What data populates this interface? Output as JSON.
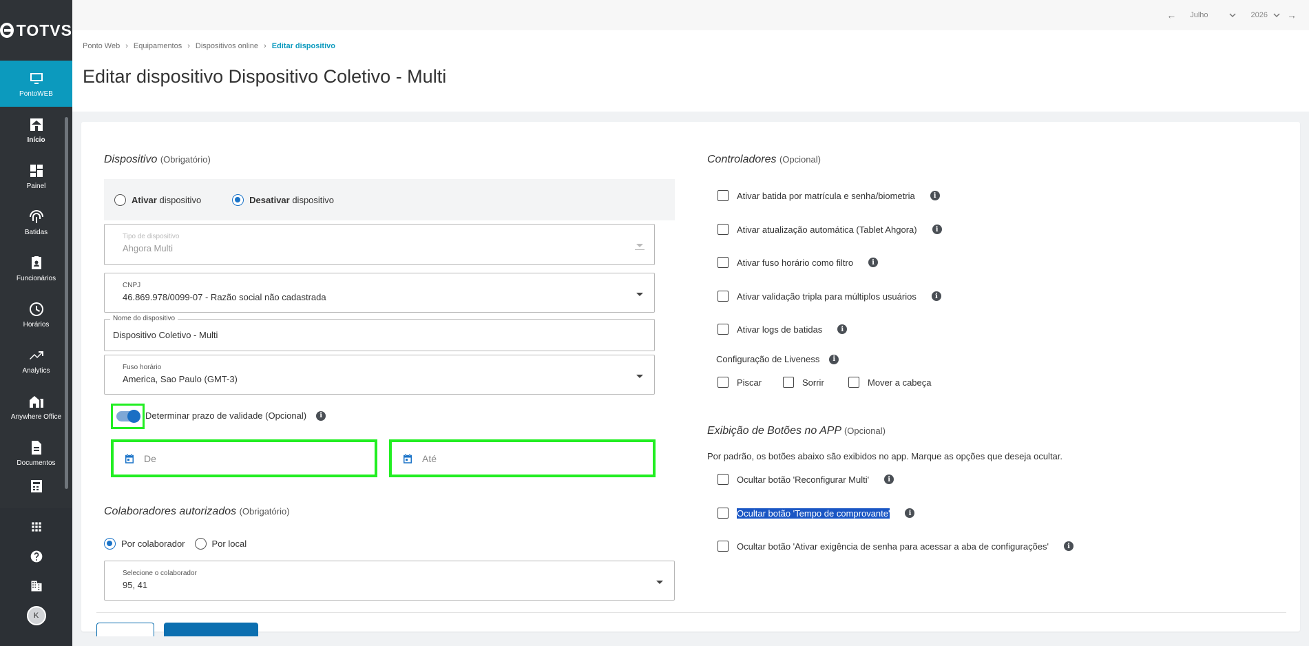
{
  "brand": "TOTVS",
  "sidebar": {
    "active_module": "PontoWEB",
    "items": [
      {
        "label": "Início",
        "icon": "home-icon"
      },
      {
        "label": "Painel",
        "icon": "dashboard-icon"
      },
      {
        "label": "Batidas",
        "icon": "fingerprint-icon"
      },
      {
        "label": "Funcionários",
        "icon": "badge-icon"
      },
      {
        "label": "Horários",
        "icon": "clock-icon"
      },
      {
        "label": "Analytics",
        "icon": "trending-icon"
      },
      {
        "label": "Anywhere Office",
        "icon": "home-office-icon"
      },
      {
        "label": "Documentos",
        "icon": "document-icon"
      }
    ],
    "avatar_initial": "K"
  },
  "period": {
    "month": "Julho",
    "year": "2026"
  },
  "breadcrumb": [
    "Ponto Web",
    "Equipamentos",
    "Dispositivos online",
    "Editar dispositivo"
  ],
  "page_title": "Editar dispositivo Dispositivo Coletivo - Multi",
  "dispositivo": {
    "title": "Dispositivo",
    "qualifier": "(Obrigatório)",
    "radio_ativar_bold": "Ativar",
    "radio_ativar_rest": " dispositivo",
    "radio_desativar_bold": "Desativar",
    "radio_desativar_rest": " dispositivo",
    "selected": "desativar",
    "tipo_label": "Tipo de dispositivo",
    "tipo_value": "Ahgora Multi",
    "cnpj_label": "CNPJ",
    "cnpj_value": "46.869.978/0099-07 - Razão social não cadastrada",
    "nome_label": "Nome do dispositivo",
    "nome_value": "Dispositivo Coletivo - Multi",
    "fuso_label": "Fuso horário",
    "fuso_value": "America, Sao Paulo (GMT-3)",
    "validade_label": "Determinar prazo de validade (Opcional)",
    "validade_on": true,
    "de_placeholder": "De",
    "ate_placeholder": "Até"
  },
  "colaboradores": {
    "title": "Colaboradores autorizados",
    "qualifier": "(Obrigatório)",
    "option_1": "Por colaborador",
    "option_2": "Por local",
    "selected": "Por colaborador",
    "select_label": "Selecione o colaborador",
    "select_value": "95, 41"
  },
  "controladores": {
    "title": "Controladores",
    "qualifier": "(Opcional)",
    "items": [
      "Ativar batida por matrícula e senha/biometria",
      "Ativar atualização automática (Tablet Ahgora)",
      "Ativar fuso horário como filtro",
      "Ativar validação tripla para múltiplos usuários",
      "Ativar logs de batidas"
    ],
    "liveness_label": "Configuração de Liveness",
    "liveness_options": [
      "Piscar",
      "Sorrir",
      "Mover a cabeça"
    ]
  },
  "botoes": {
    "title": "Exibição de Botões no APP",
    "qualifier": "(Opcional)",
    "description": "Por padrão, os botões abaixo são exibidos no app. Marque as opções que deseja ocultar.",
    "items": [
      "Ocultar botão 'Reconfigurar Multi'",
      "Ocultar botão 'Tempo de comprovante'",
      "Ocultar botão 'Ativar exigência de senha para acessar a aba de configurações'"
    ]
  },
  "colors": {
    "accent": "#0c9abe",
    "primary": "#1a73c8",
    "highlight": "#22ee22"
  }
}
